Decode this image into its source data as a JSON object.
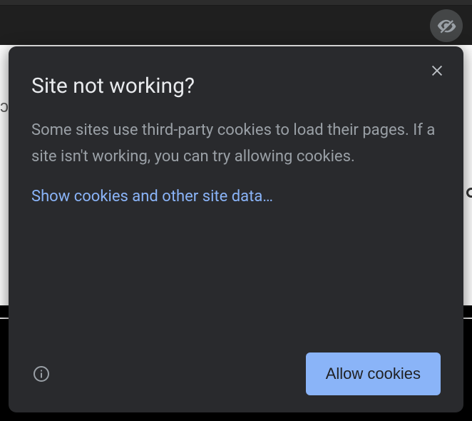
{
  "popover": {
    "title": "Site not working?",
    "body": "Some sites use third-party cookies to load their pages. If a site isn't working, you can try allowing cookies.",
    "link_label": "Show cookies and other site data…",
    "allow_button_label": "Allow cookies"
  }
}
